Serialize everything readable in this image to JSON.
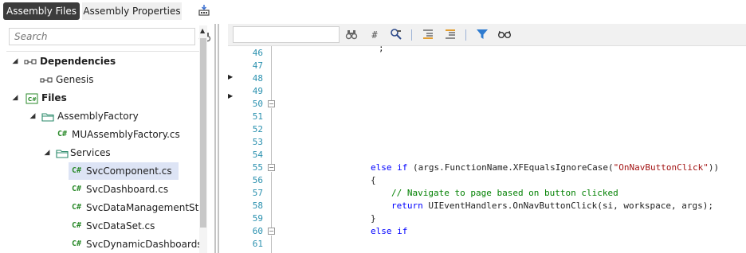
{
  "tabs": {
    "assembly_files": "Assembly Files",
    "assembly_properties": "Assembly Properties"
  },
  "search": {
    "placeholder": "Search"
  },
  "tree": {
    "items": [
      {
        "label": "Dependencies",
        "icon": "dependency-icon",
        "expander": "◢",
        "bold": true
      },
      {
        "label": "Genesis",
        "icon": "dependency-icon",
        "expander": "",
        "bold": false
      },
      {
        "label": "Files",
        "icon": "csharp-project-icon",
        "expander": "◢",
        "bold": true
      },
      {
        "label": "AssemblyFactory",
        "icon": "folder-icon",
        "expander": "◢",
        "bold": false
      },
      {
        "label": "MUAssemblyFactory.cs",
        "icon": "csharp-file-icon",
        "expander": "",
        "bold": false
      },
      {
        "label": "Services",
        "icon": "folder-icon",
        "expander": "◢",
        "bold": false
      },
      {
        "label": "SvcComponent.cs",
        "icon": "csharp-file-icon",
        "expander": "",
        "bold": false,
        "selected": true
      },
      {
        "label": "SvcDashboard.cs",
        "icon": "csharp-file-icon",
        "expander": "",
        "bold": false
      },
      {
        "label": "SvcDataManagementStep.cs",
        "icon": "csharp-file-icon",
        "expander": "",
        "bold": false
      },
      {
        "label": "SvcDataSet.cs",
        "icon": "csharp-file-icon",
        "expander": "",
        "bold": false
      },
      {
        "label": "SvcDynamicDashboards.cs",
        "icon": "csharp-file-icon",
        "expander": "",
        "bold": false
      }
    ]
  },
  "csharp_glyph": "C#",
  "editor": {
    "toolbar_icons": [
      "find-icon",
      "hash-icon",
      "search-replace-icon",
      "indent-icon",
      "outdent-icon",
      "filter-icon",
      "glasses-icon"
    ],
    "line_numbers": [
      "46",
      "47",
      "48",
      "49",
      "50",
      "51",
      "52",
      "53",
      "54",
      "55",
      "56",
      "57",
      "58",
      "59",
      "60",
      "61"
    ],
    "lines": {
      "l46": ";",
      "l55_kw1": "else if",
      "l55_a": " (args.FunctionName.XFEqualsIgnoreCase(",
      "l55_str": "\"OnNavButtonClick\"",
      "l55_b": "))",
      "l56": "{",
      "l57": "// Navigate to page based on button clicked",
      "l58_kw": "return",
      "l58_a": " UIEventHandlers.OnNavButtonClick(si, workspace, args);",
      "l59": "}",
      "l60": "else if"
    }
  },
  "colors": {
    "tab_active_bg": "#3c3c3c",
    "keyword": "#0000ff",
    "string": "#a31515",
    "comment": "#008000",
    "line_number": "#2b91af",
    "selection": "#dde4f5"
  }
}
